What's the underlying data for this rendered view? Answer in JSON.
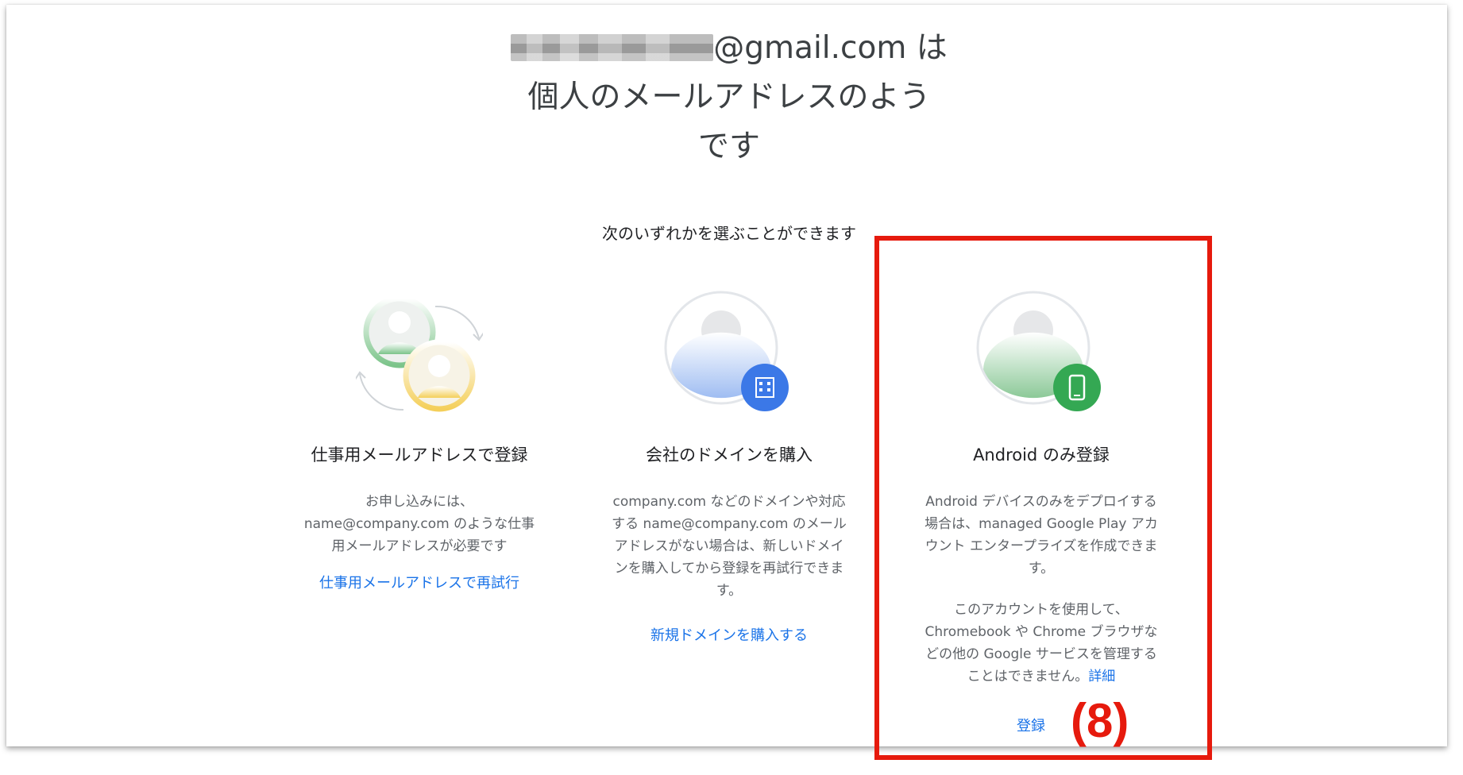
{
  "header": {
    "title_email_suffix": "@gmail.com は",
    "title_line2": "個人のメールアドレスのよう",
    "title_line3": "です",
    "subtitle": "次のいずれかを選ぶことができます"
  },
  "options": [
    {
      "heading": "仕事用メールアドレスで登録",
      "description": "お申し込みには、name@company.com のような仕事用メールアドレスが必要です",
      "link": "仕事用メールアドレスで再試行",
      "icon": "account-switch-icon"
    },
    {
      "heading": "会社のドメインを購入",
      "description": "company.com などのドメインや対応する name@company.com のメールアドレスがない場合は、新しいドメインを購入してから登録を再試行できます。",
      "link": "新規ドメインを購入する",
      "icon": "account-building-icon"
    },
    {
      "heading": "Android のみ登録",
      "description": "Android デバイスのみをデプロイする場合は、managed Google Play アカウント エンタープライズを作成できます。",
      "description2": "このアカウントを使用して、Chromebook や Chrome ブラウザなどの他の Google サービスを管理することはできません。",
      "details_link": "詳細",
      "link": "登録",
      "icon": "account-phone-icon"
    }
  ],
  "annotation": {
    "label": "(8)",
    "color": "#e61a0d"
  },
  "colors": {
    "link": "#1a73e8",
    "building_badge": "#3b78e7",
    "phone_badge": "#34a853"
  }
}
